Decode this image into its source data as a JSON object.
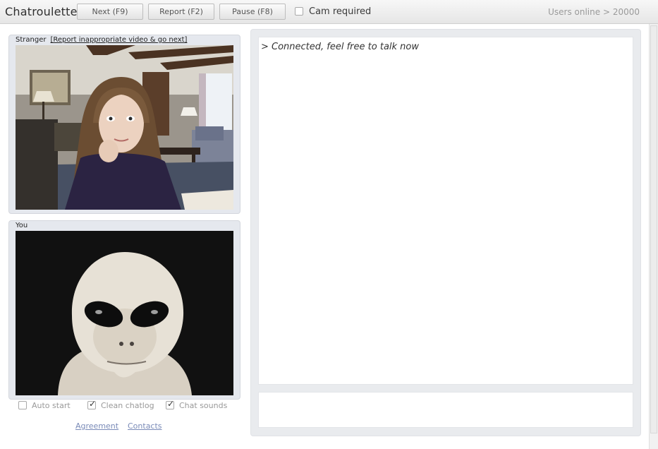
{
  "app": {
    "title": "Chatroulette"
  },
  "toolbar": {
    "next_label": "Next (F9)",
    "report_label": "Report (F2)",
    "pause_label": "Pause (F8)",
    "cam_required_label": "Cam required",
    "cam_required_checked": false,
    "users_online": "Users online > 20000"
  },
  "stranger": {
    "label": "Stranger",
    "report_link": "[Report inappropriate video & go next]"
  },
  "you": {
    "label": "You"
  },
  "options": {
    "auto_start": {
      "label": "Auto start",
      "checked": false
    },
    "clean_chatlog": {
      "label": "Clean chatlog",
      "checked": true
    },
    "chat_sounds": {
      "label": "Chat sounds",
      "checked": true
    }
  },
  "links": {
    "agreement": "Agreement",
    "contacts": "Contacts"
  },
  "chat": {
    "messages": [
      "> Connected, feel free to talk now"
    ],
    "input_value": ""
  },
  "colors": {
    "panel_bg": "#e5e8ee",
    "link": "#7a8bb8"
  }
}
